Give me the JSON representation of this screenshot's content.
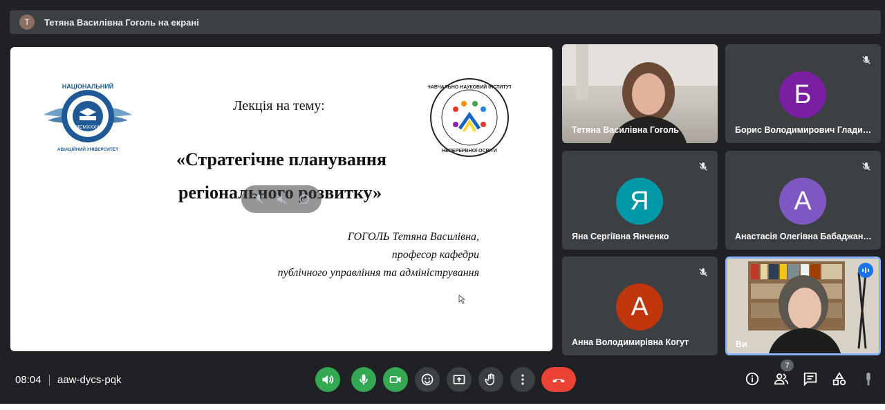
{
  "banner": {
    "avatar_letter": "Т",
    "text": "Тетяна Василівна Гоголь на екрані"
  },
  "slide": {
    "topic": "Лекція на тему:",
    "title_line1": "«Стратегічне планування",
    "title_line2": "регіонального розвитку»",
    "author_line1": "ГОГОЛЬ Тетяна Василівна,",
    "author_line2": "професор кафедри",
    "author_line3": "публічного управління та адміністрування",
    "logo_left": {
      "arc_text": "НАЦІОНАЛЬНИЙ",
      "year": "MCMXXXIII",
      "bottom_text": "АВІАЦІЙНИЙ УНІВЕРСИТЕТ"
    },
    "logo_right": {
      "top_text": "НАВЧАЛЬНО НАУКОВИЙ ІНСТИТУТ",
      "bottom_text": "НЕПЕРЕРВНОЇ ОСВІТИ"
    }
  },
  "participants": [
    {
      "name": "Тетяна Василівна Гоголь",
      "type": "video"
    },
    {
      "name": "Борис Володимирович Гладин…",
      "initial": "Б",
      "color": "#7b1fa2",
      "muted": true
    },
    {
      "name": "Яна Сергіївна Янченко",
      "initial": "Я",
      "color": "#0097a7",
      "muted": true
    },
    {
      "name": "Анастасія Олегівна Бабаджан…",
      "initial": "А",
      "color": "#7e57c2",
      "muted": true
    },
    {
      "name": "Анна Володимирівна Когут",
      "initial": "А",
      "color": "#bf360c",
      "muted": true
    },
    {
      "name": "Ви",
      "type": "self",
      "speaking": true
    }
  ],
  "meeting": {
    "time": "08:04",
    "code": "aaw-dycs-pqk",
    "participant_count": "7"
  },
  "controls": [
    {
      "name": "speaker-icon",
      "state": "on"
    },
    {
      "name": "microphone-icon",
      "state": "on"
    },
    {
      "name": "camera-icon",
      "state": "on"
    },
    {
      "name": "emoji-icon"
    },
    {
      "name": "present-screen-icon"
    },
    {
      "name": "raise-hand-icon"
    },
    {
      "name": "more-options-icon"
    },
    {
      "name": "end-call-icon"
    }
  ],
  "right_icons": [
    "info-icon",
    "people-icon",
    "chat-icon",
    "activities-icon",
    "mic-pin-icon"
  ],
  "colors": {
    "background": "#202124",
    "green": "#34a853",
    "red": "#ea4335",
    "blue_speaking": "#1a73e8"
  }
}
